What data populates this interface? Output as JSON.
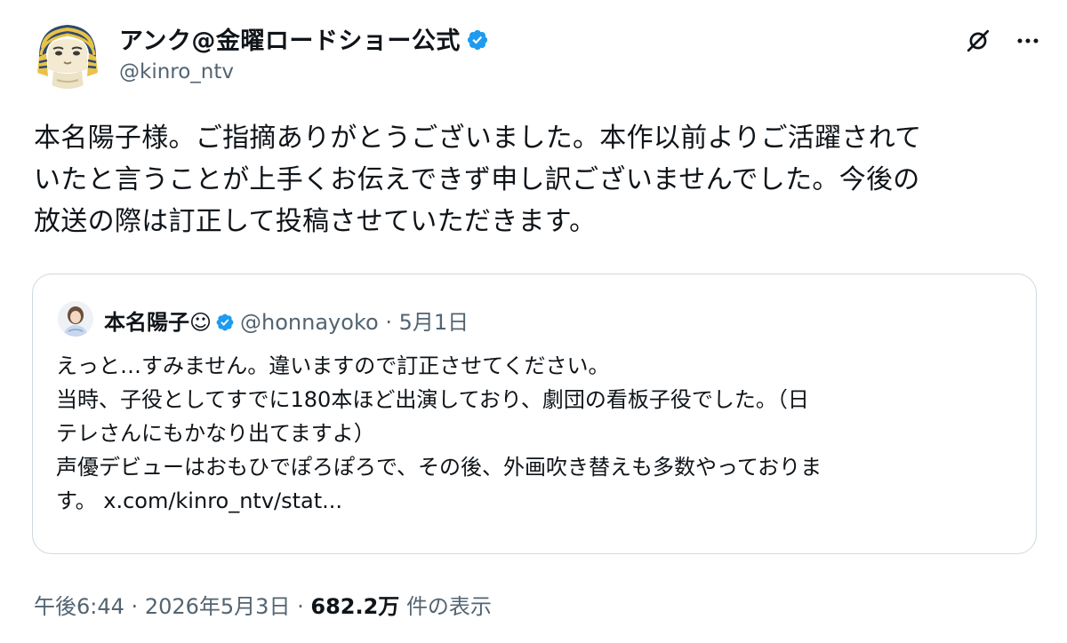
{
  "author": {
    "name": "アンク@金曜ロードショー公式",
    "handle": "@kinro_ntv",
    "verified": true,
    "avatar_icon": "pharaoh-mascot-avatar"
  },
  "actions": {
    "grok_icon": "grok-icon",
    "more_icon": "more-options-icon",
    "more_label": "···"
  },
  "tweet": {
    "text": "本名陽子様。ご指摘ありがとうございました。本作以前よりご活躍されて\nいたと言うことが上手くお伝えできず申し訳ございませんでした。今後の\n放送の際は訂正して投稿させていただきます。"
  },
  "quote": {
    "name": "本名陽子☺",
    "handle": "@honnayoko",
    "separator": "·",
    "date": "5月1日",
    "text": "えっと…すみません。違いますので訂正させてください。\n当時、子役としてすでに180本ほど出演しており、劇団の看板子役でした。（日\nテレさんにもかなり出てますよ）\n声優デビューはおもひでぽろぽろで、その後、外画吹き替えも多数やっておりま\nす。 ",
    "link": "x.com/kinro_ntv/stat..."
  },
  "meta": {
    "time": "午後6:44",
    "separator": "·",
    "date": "2026年5月3日",
    "views_count": "682.2万",
    "views_label": "件の表示"
  },
  "colors": {
    "verified_blue": "#1d9bf0",
    "secondary_text": "#536471",
    "border": "#cfd9de"
  }
}
